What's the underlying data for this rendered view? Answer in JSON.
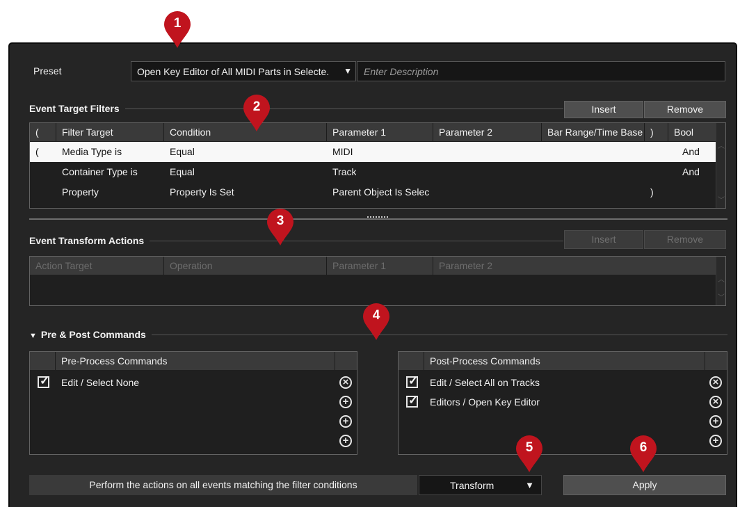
{
  "preset": {
    "label": "Preset",
    "selected": "Open Key Editor of All MIDI Parts in Selecte.",
    "description_placeholder": "Enter Description"
  },
  "filters": {
    "title": "Event Target Filters",
    "insert_label": "Insert",
    "remove_label": "Remove",
    "columns": [
      "(",
      "Filter Target",
      "Condition",
      "Parameter 1",
      "Parameter 2",
      "Bar Range/Time Base",
      ")",
      "Bool"
    ],
    "rows": [
      {
        "open": "(",
        "target": "Media Type is",
        "condition": "Equal",
        "p1": "MIDI",
        "p2": "",
        "range": "",
        "close": "",
        "bool": "And"
      },
      {
        "open": "",
        "target": "Container Type is",
        "condition": "Equal",
        "p1": "Track",
        "p2": "",
        "range": "",
        "close": "",
        "bool": "And"
      },
      {
        "open": "",
        "target": "Property",
        "condition": "Property Is Set",
        "p1": "Parent Object Is Selec",
        "p2": "",
        "range": "",
        "close": ")",
        "bool": ""
      }
    ]
  },
  "actions": {
    "title": "Event Transform Actions",
    "insert_label": "Insert",
    "remove_label": "Remove",
    "columns": [
      "Action Target",
      "Operation",
      "Parameter 1",
      "Parameter 2"
    ]
  },
  "commands": {
    "title": "Pre & Post Commands",
    "toggle_icon": "▼",
    "pre": {
      "header": "Pre-Process Commands",
      "items": [
        {
          "label": "Edit / Select None",
          "checked": true
        }
      ],
      "remove_icon": "⊗",
      "add_icon": "⊕"
    },
    "post": {
      "header": "Post-Process Commands",
      "items": [
        {
          "label": "Edit / Select All on Tracks",
          "checked": true
        },
        {
          "label": "Editors / Open Key Editor",
          "checked": true
        }
      ]
    }
  },
  "footer": {
    "status": "Perform the actions on all events matching the filter conditions",
    "mode": "Transform",
    "mode_arrow": "▼",
    "apply_label": "Apply"
  },
  "callouts": [
    "1",
    "2",
    "3",
    "4",
    "5",
    "6"
  ],
  "colors": {
    "callout": "#c0141e",
    "panel": "#252525",
    "selected_row": "#f8f8f8"
  }
}
